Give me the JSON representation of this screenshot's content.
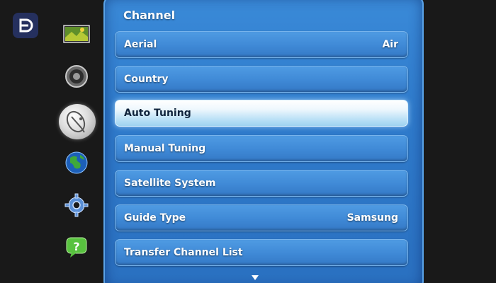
{
  "brand": {
    "icon": "brand-logo-icon"
  },
  "sidebar": {
    "items": [
      {
        "name": "picture",
        "icon": "picture-icon",
        "selected": false
      },
      {
        "name": "sound",
        "icon": "speaker-icon",
        "selected": false
      },
      {
        "name": "channel",
        "icon": "satellite-dish-icon",
        "selected": true
      },
      {
        "name": "network",
        "icon": "globe-icon",
        "selected": false
      },
      {
        "name": "system",
        "icon": "gear-icon",
        "selected": false
      },
      {
        "name": "support",
        "icon": "help-bubble-icon",
        "selected": false
      }
    ]
  },
  "menu": {
    "title": "Channel",
    "items": [
      {
        "label": "Aerial",
        "value": "Air",
        "selected": false
      },
      {
        "label": "Country",
        "value": "",
        "selected": false
      },
      {
        "label": "Auto Tuning",
        "value": "",
        "selected": true
      },
      {
        "label": "Manual Tuning",
        "value": "",
        "selected": false
      },
      {
        "label": "Satellite System",
        "value": "",
        "selected": false
      },
      {
        "label": "Guide Type",
        "value": "Samsung",
        "selected": false
      },
      {
        "label": "Transfer Channel List",
        "value": "",
        "selected": false
      }
    ],
    "more_indicator": "scroll-down-arrow-icon"
  },
  "colors": {
    "panel": "#2f7bcc",
    "item": "#3f89d6",
    "item_selected": "#c7e8f8",
    "background": "#191919"
  }
}
